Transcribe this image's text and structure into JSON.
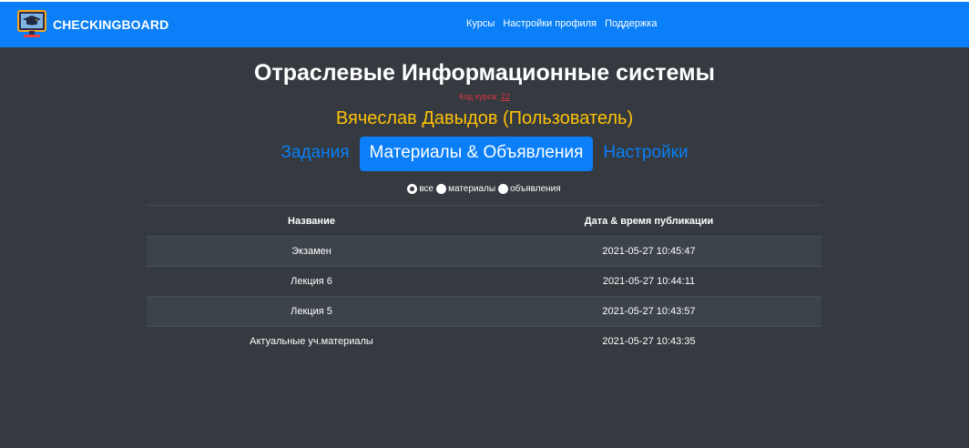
{
  "navbar": {
    "brand": "CHECKINGBOARD",
    "brand_icon": "graduation-monitor-icon",
    "links": [
      "Курсы",
      "Настройки профиля",
      "Поддержка"
    ],
    "background": "#0a7ff7"
  },
  "course": {
    "title": "Отраслевые Информационные системы",
    "code_label": "Код курса:",
    "code_value": "22",
    "user": "Вячеслав Давыдов (Пользователь)"
  },
  "tabs": [
    {
      "label": "Задания",
      "active": false
    },
    {
      "label": "Материалы & Объявления",
      "active": true
    },
    {
      "label": "Настройки",
      "active": false
    }
  ],
  "filters": {
    "options": [
      "все",
      "материалы",
      "объявления"
    ],
    "selected": "все"
  },
  "table": {
    "headers": [
      "Название",
      "Дата & время публикации"
    ],
    "rows": [
      {
        "name": "Экзамен",
        "date": "2021-05-27 10:45:47"
      },
      {
        "name": "Лекция 6",
        "date": "2021-05-27 10:44:11"
      },
      {
        "name": "Лекция 5",
        "date": "2021-05-27 10:43:57"
      },
      {
        "name": "Актуальные уч.материалы",
        "date": "2021-05-27 10:43:35"
      }
    ]
  },
  "colors": {
    "page_background": "#343a40",
    "accent": "#0a7ff7",
    "user_name": "#ffc107",
    "code": "#dc3545"
  }
}
